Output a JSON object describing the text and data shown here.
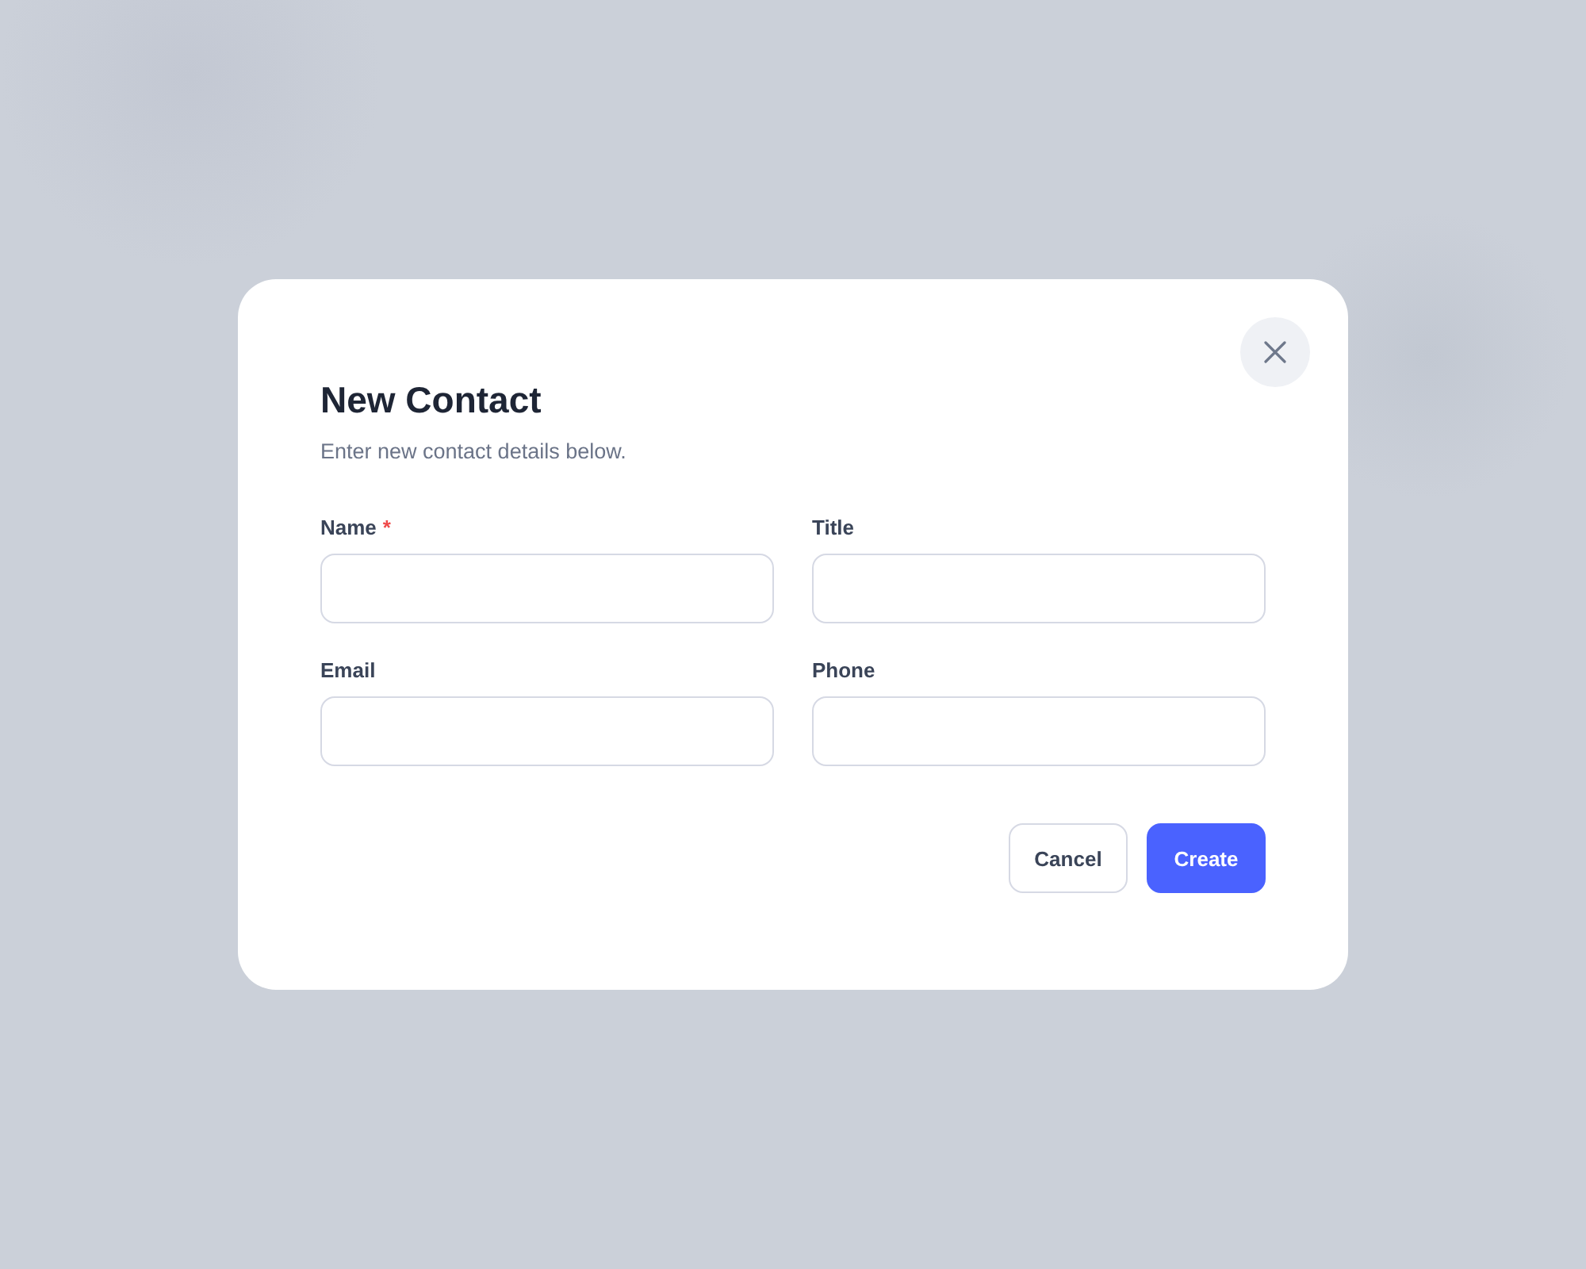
{
  "dialog": {
    "title": "New Contact",
    "subtitle": "Enter new contact details below.",
    "required_mark": "*"
  },
  "fields": [
    {
      "label": "Name",
      "required": true
    },
    {
      "label": "Title",
      "required": false
    },
    {
      "label": "Email",
      "required": false
    },
    {
      "label": "Phone",
      "required": false
    }
  ],
  "buttons": [
    {
      "label": "Cancel",
      "kind": "secondary"
    },
    {
      "label": "Create",
      "kind": "primary"
    }
  ]
}
